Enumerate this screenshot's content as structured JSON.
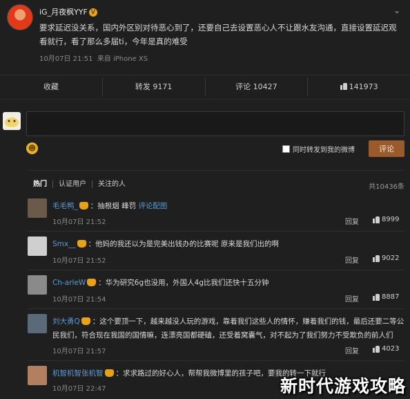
{
  "post": {
    "author": "iG_月夜枫YYF",
    "vip_badge": "V",
    "text": "要求延迟没关系，国内外区别对待恶心到了，还要自己去设置恶心人不让跟水友沟通，直接设置延迟观看就行，看了那么多届ti，今年是真的难受",
    "time": "10月07日 21:51",
    "source": "来自 iPhone XS",
    "menu_icon": "chevron-down-icon"
  },
  "actions": {
    "favorite": "收藏",
    "repost": "转发 9171",
    "comment": "评论 10427",
    "like": "141973"
  },
  "composer": {
    "forward_checkbox_label": "同时转发到我的微博",
    "submit": "评论"
  },
  "comments_header": {
    "tabs": [
      "热门",
      "认证用户",
      "关注的人"
    ],
    "total": "共10436条"
  },
  "comments": [
    {
      "name": "毛毛鸭_",
      "text": "：抽根烟 峰罚",
      "link": "评论配图",
      "time": "10月07日 21:52",
      "reply": "回复",
      "likes": "8999",
      "avatar_color": "#6b5a4a"
    },
    {
      "name": "Smx__",
      "text": "：他妈的我还以为是完美出钱办的比赛呢 原来是我们出的啊",
      "link": "",
      "time": "10月07日 21:52",
      "reply": "回复",
      "likes": "9022",
      "avatar_color": "#cfcfcf"
    },
    {
      "name": "Ch-arleW",
      "text": "：华为研究6g也没用，外国人4g比我们还快十五分钟",
      "link": "",
      "time": "10月07日 21:54",
      "reply": "回复",
      "likes": "8887",
      "avatar_color": "#8a8a8a"
    },
    {
      "name": "刘大勇Q",
      "text": "：这个要顶一下，越来越没人玩的游戏，靠着我们这些人的情怀，赚着我们的钱，最后还要二等公民我们，符合现在我国的国情嘛，连漂亮国都硬磕，还受着窝囊气，对不起为了我们努力不受欺负的前人们",
      "link": "",
      "time": "10月07日 21:57",
      "reply": "回复",
      "likes": "4023",
      "avatar_color": "#5a6a7a"
    },
    {
      "name": "机智机智张机智",
      "text": "：求求路过的好心人，帮帮我微博里的孩子吧，要我的转一下就行",
      "link": "",
      "time": "10月07日 22:47",
      "reply": "回复",
      "likes": "",
      "avatar_color": "#b08060"
    }
  ],
  "watermark": "新时代游戏攻略"
}
